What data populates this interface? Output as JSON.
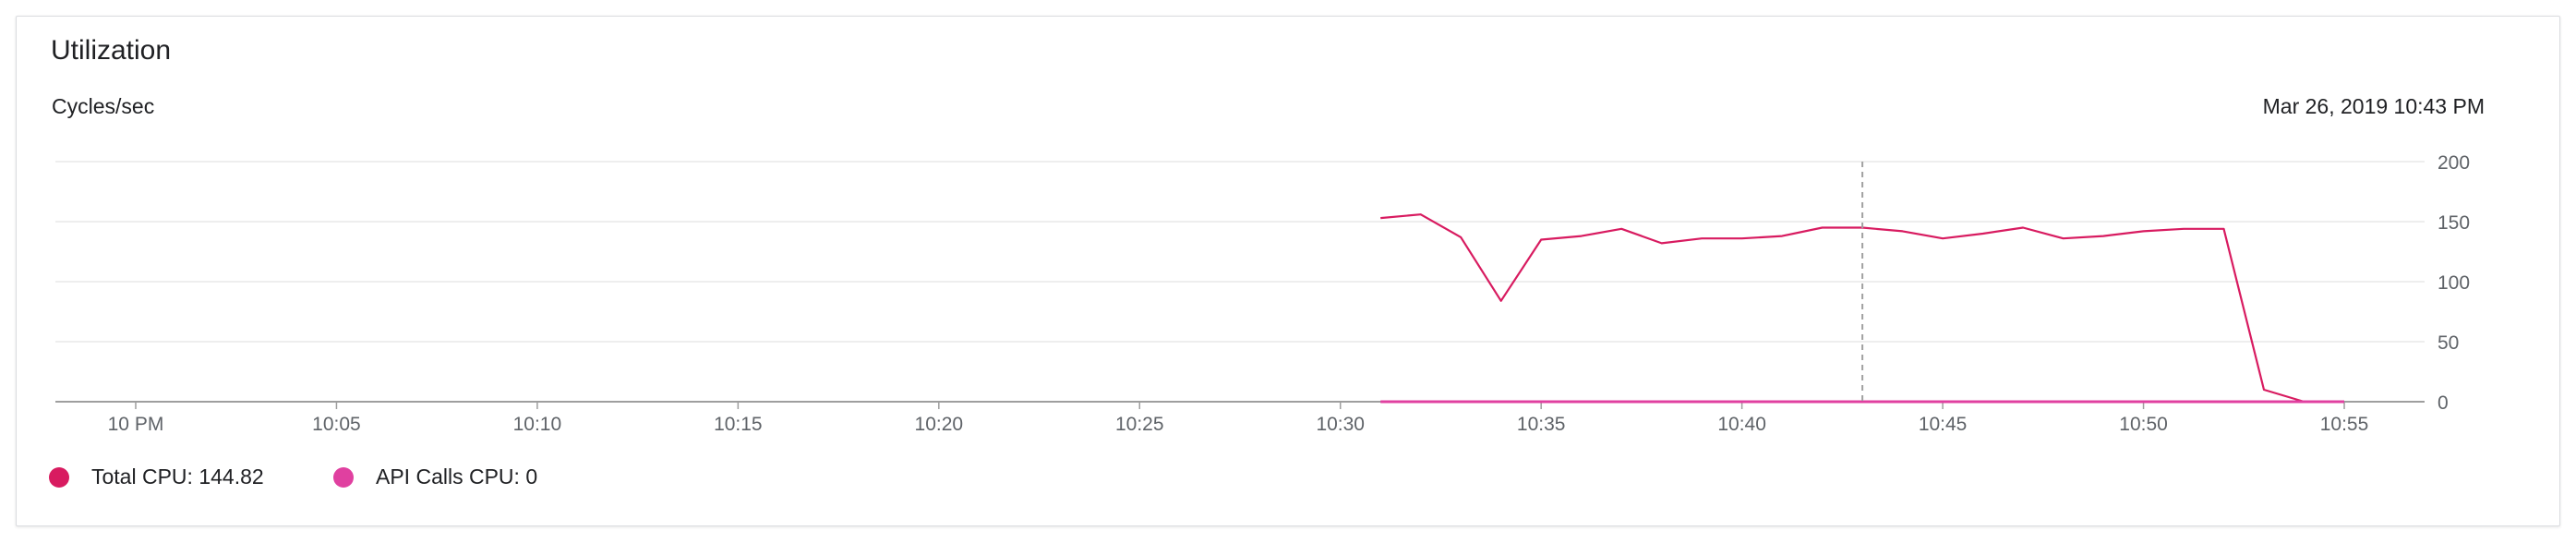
{
  "panel": {
    "title": "Utilization",
    "unit_label": "Cycles/sec",
    "hover_timestamp": "Mar 26, 2019 10:43 PM"
  },
  "colors": {
    "total_cpu": "#d81b60",
    "api_calls_cpu": "#e040a0",
    "grid": "#e8e8e8",
    "axis": "#9e9e9e",
    "hover_line": "#a0a0a0"
  },
  "legend": [
    {
      "label": "Total CPU: 144.82",
      "color": "#d81b60"
    },
    {
      "label": "API Calls CPU: 0",
      "color": "#e040a0"
    }
  ],
  "chart_data": {
    "type": "line",
    "title": "Utilization",
    "ylabel": "Cycles/sec",
    "ylim": [
      0,
      200
    ],
    "yticks": [
      "200",
      "150",
      "100",
      "50",
      "0"
    ],
    "xlim": [
      "9:58 PM",
      "10:57 PM"
    ],
    "xticks": [
      "10 PM",
      "10:05",
      "10:10",
      "10:15",
      "10:20",
      "10:25",
      "10:30",
      "10:35",
      "10:40",
      "10:45",
      "10:50",
      "10:55"
    ],
    "grid": true,
    "legend_position": "bottom-left",
    "hover_time": "10:43 PM",
    "series": [
      {
        "name": "Total CPU",
        "x": [
          "10:31",
          "10:32",
          "10:33",
          "10:34",
          "10:35",
          "10:36",
          "10:37",
          "10:38",
          "10:39",
          "10:40",
          "10:41",
          "10:42",
          "10:43",
          "10:44",
          "10:45",
          "10:46",
          "10:47",
          "10:48",
          "10:49",
          "10:50",
          "10:51",
          "10:52",
          "10:53",
          "10:54",
          "10:55"
        ],
        "values": [
          153,
          156,
          137,
          84,
          135,
          138,
          144,
          132,
          136,
          136,
          138,
          145,
          145,
          142,
          136,
          140,
          145,
          136,
          138,
          142,
          144,
          144,
          10,
          0,
          0
        ]
      },
      {
        "name": "API Calls CPU",
        "x": [
          "10:31",
          "10:55"
        ],
        "values": [
          0,
          0
        ]
      }
    ]
  }
}
